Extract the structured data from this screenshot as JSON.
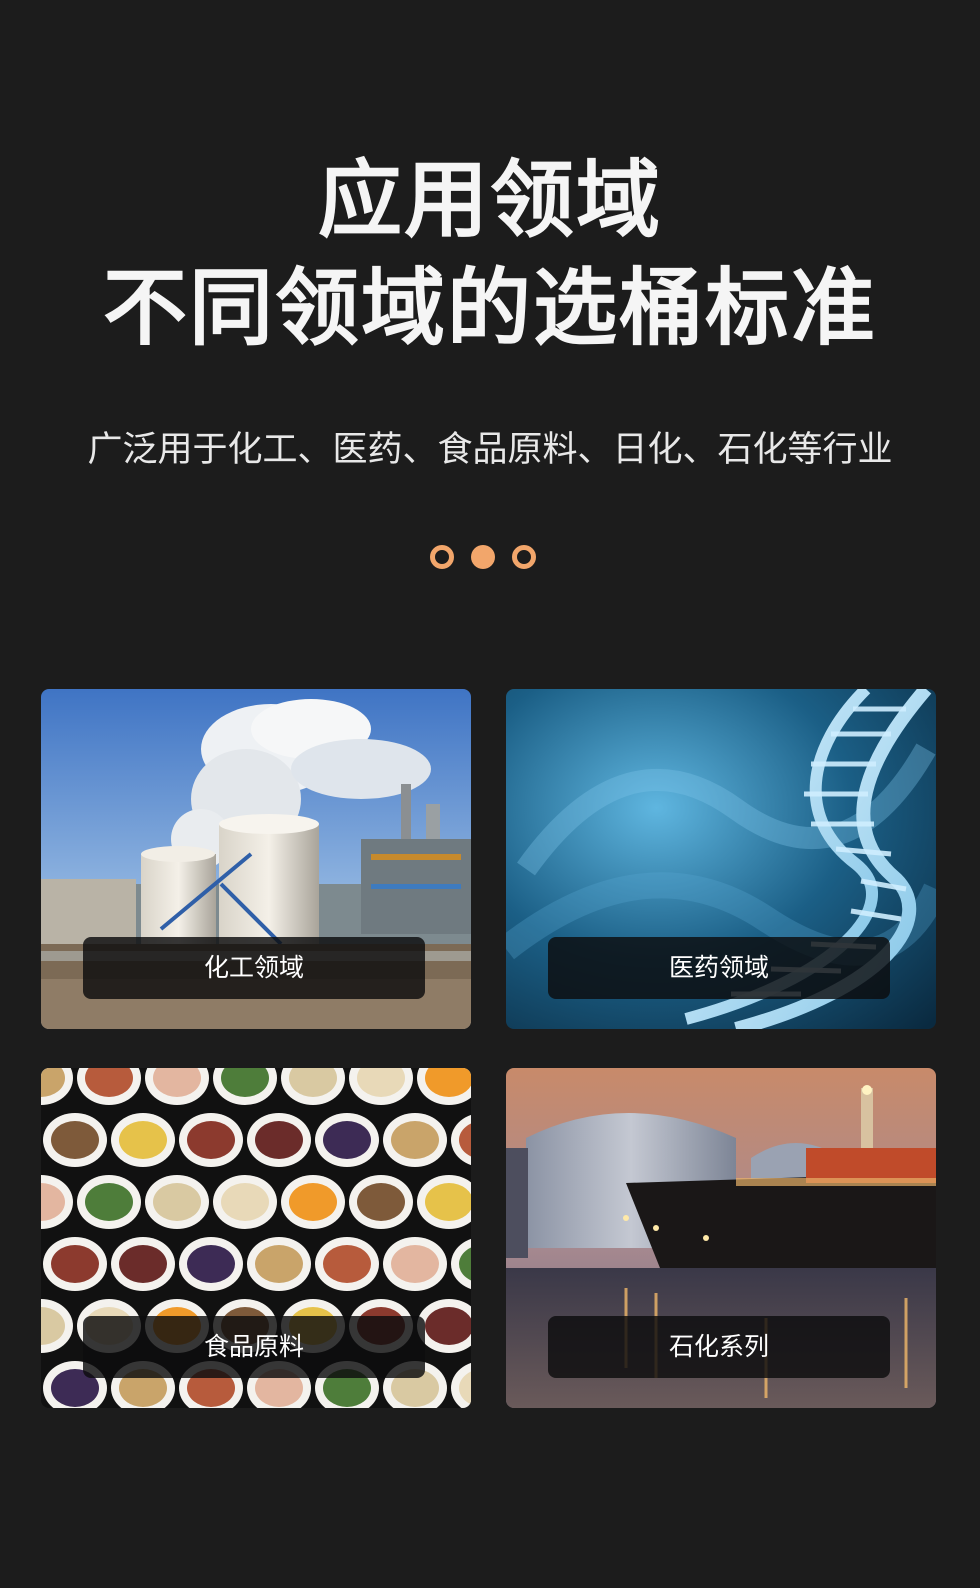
{
  "header": {
    "title_line1": "应用领域",
    "title_line2": "不同领域的选桶标准",
    "subtitle": "广泛用于化工、医药、食品原料、日化、石化等行业"
  },
  "pager": {
    "dots": [
      "ring",
      "fill",
      "ring"
    ],
    "accent_color": "#f2a66b"
  },
  "cards": [
    {
      "label": "化工领域",
      "image": "chemical-plant-image"
    },
    {
      "label": "医药领域",
      "image": "dna-helix-image"
    },
    {
      "label": "食品原料",
      "image": "food-bowls-image"
    },
    {
      "label": "石化系列",
      "image": "tanker-port-image"
    }
  ],
  "colors": {
    "background": "#1c1c1c",
    "label_bg": "#0c0c0e"
  }
}
